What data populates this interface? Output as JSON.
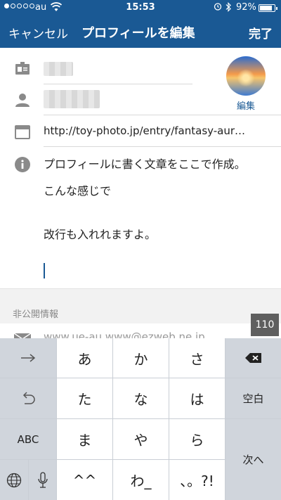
{
  "status_bar": {
    "carrier": "au",
    "time": "15:53",
    "battery_percent": "92%",
    "battery_level": 0.92,
    "signal_dots_filled": 1,
    "signal_dots_total": 5,
    "icons": [
      "wifi-icon",
      "alarm-icon",
      "bluetooth-icon",
      "battery-icon"
    ]
  },
  "nav": {
    "cancel_label": "キャンセル",
    "title": "プロフィールを編集",
    "done_label": "完了",
    "background": "#1a5994"
  },
  "profile": {
    "avatar_edit_label": "編集",
    "website": "http://toy-photo.jp/entry/fantasy-aur…",
    "bio_lines": [
      "プロフィールに書く文章をここで作成。",
      "こんな感じで",
      "改行も入れれますよ。"
    ],
    "icons": [
      "id-card-icon",
      "person-icon",
      "browser-window-icon",
      "info-icon"
    ]
  },
  "private_section": {
    "label": "非公開情報",
    "email_partial": "www.ue-au.www@ezweb.ne.jp",
    "email_icon": "envelope-icon"
  },
  "counter": "110",
  "keyboard": {
    "row1": [
      "→",
      "あ",
      "か",
      "さ",
      "⌫"
    ],
    "row2": [
      "↺",
      "た",
      "な",
      "は",
      "空白"
    ],
    "row3": [
      "ABC",
      "ま",
      "や",
      "ら"
    ],
    "row4": [
      "🌐",
      "🎤",
      "^^",
      "わ_",
      "、。?!"
    ],
    "enter_label": "次へ"
  }
}
